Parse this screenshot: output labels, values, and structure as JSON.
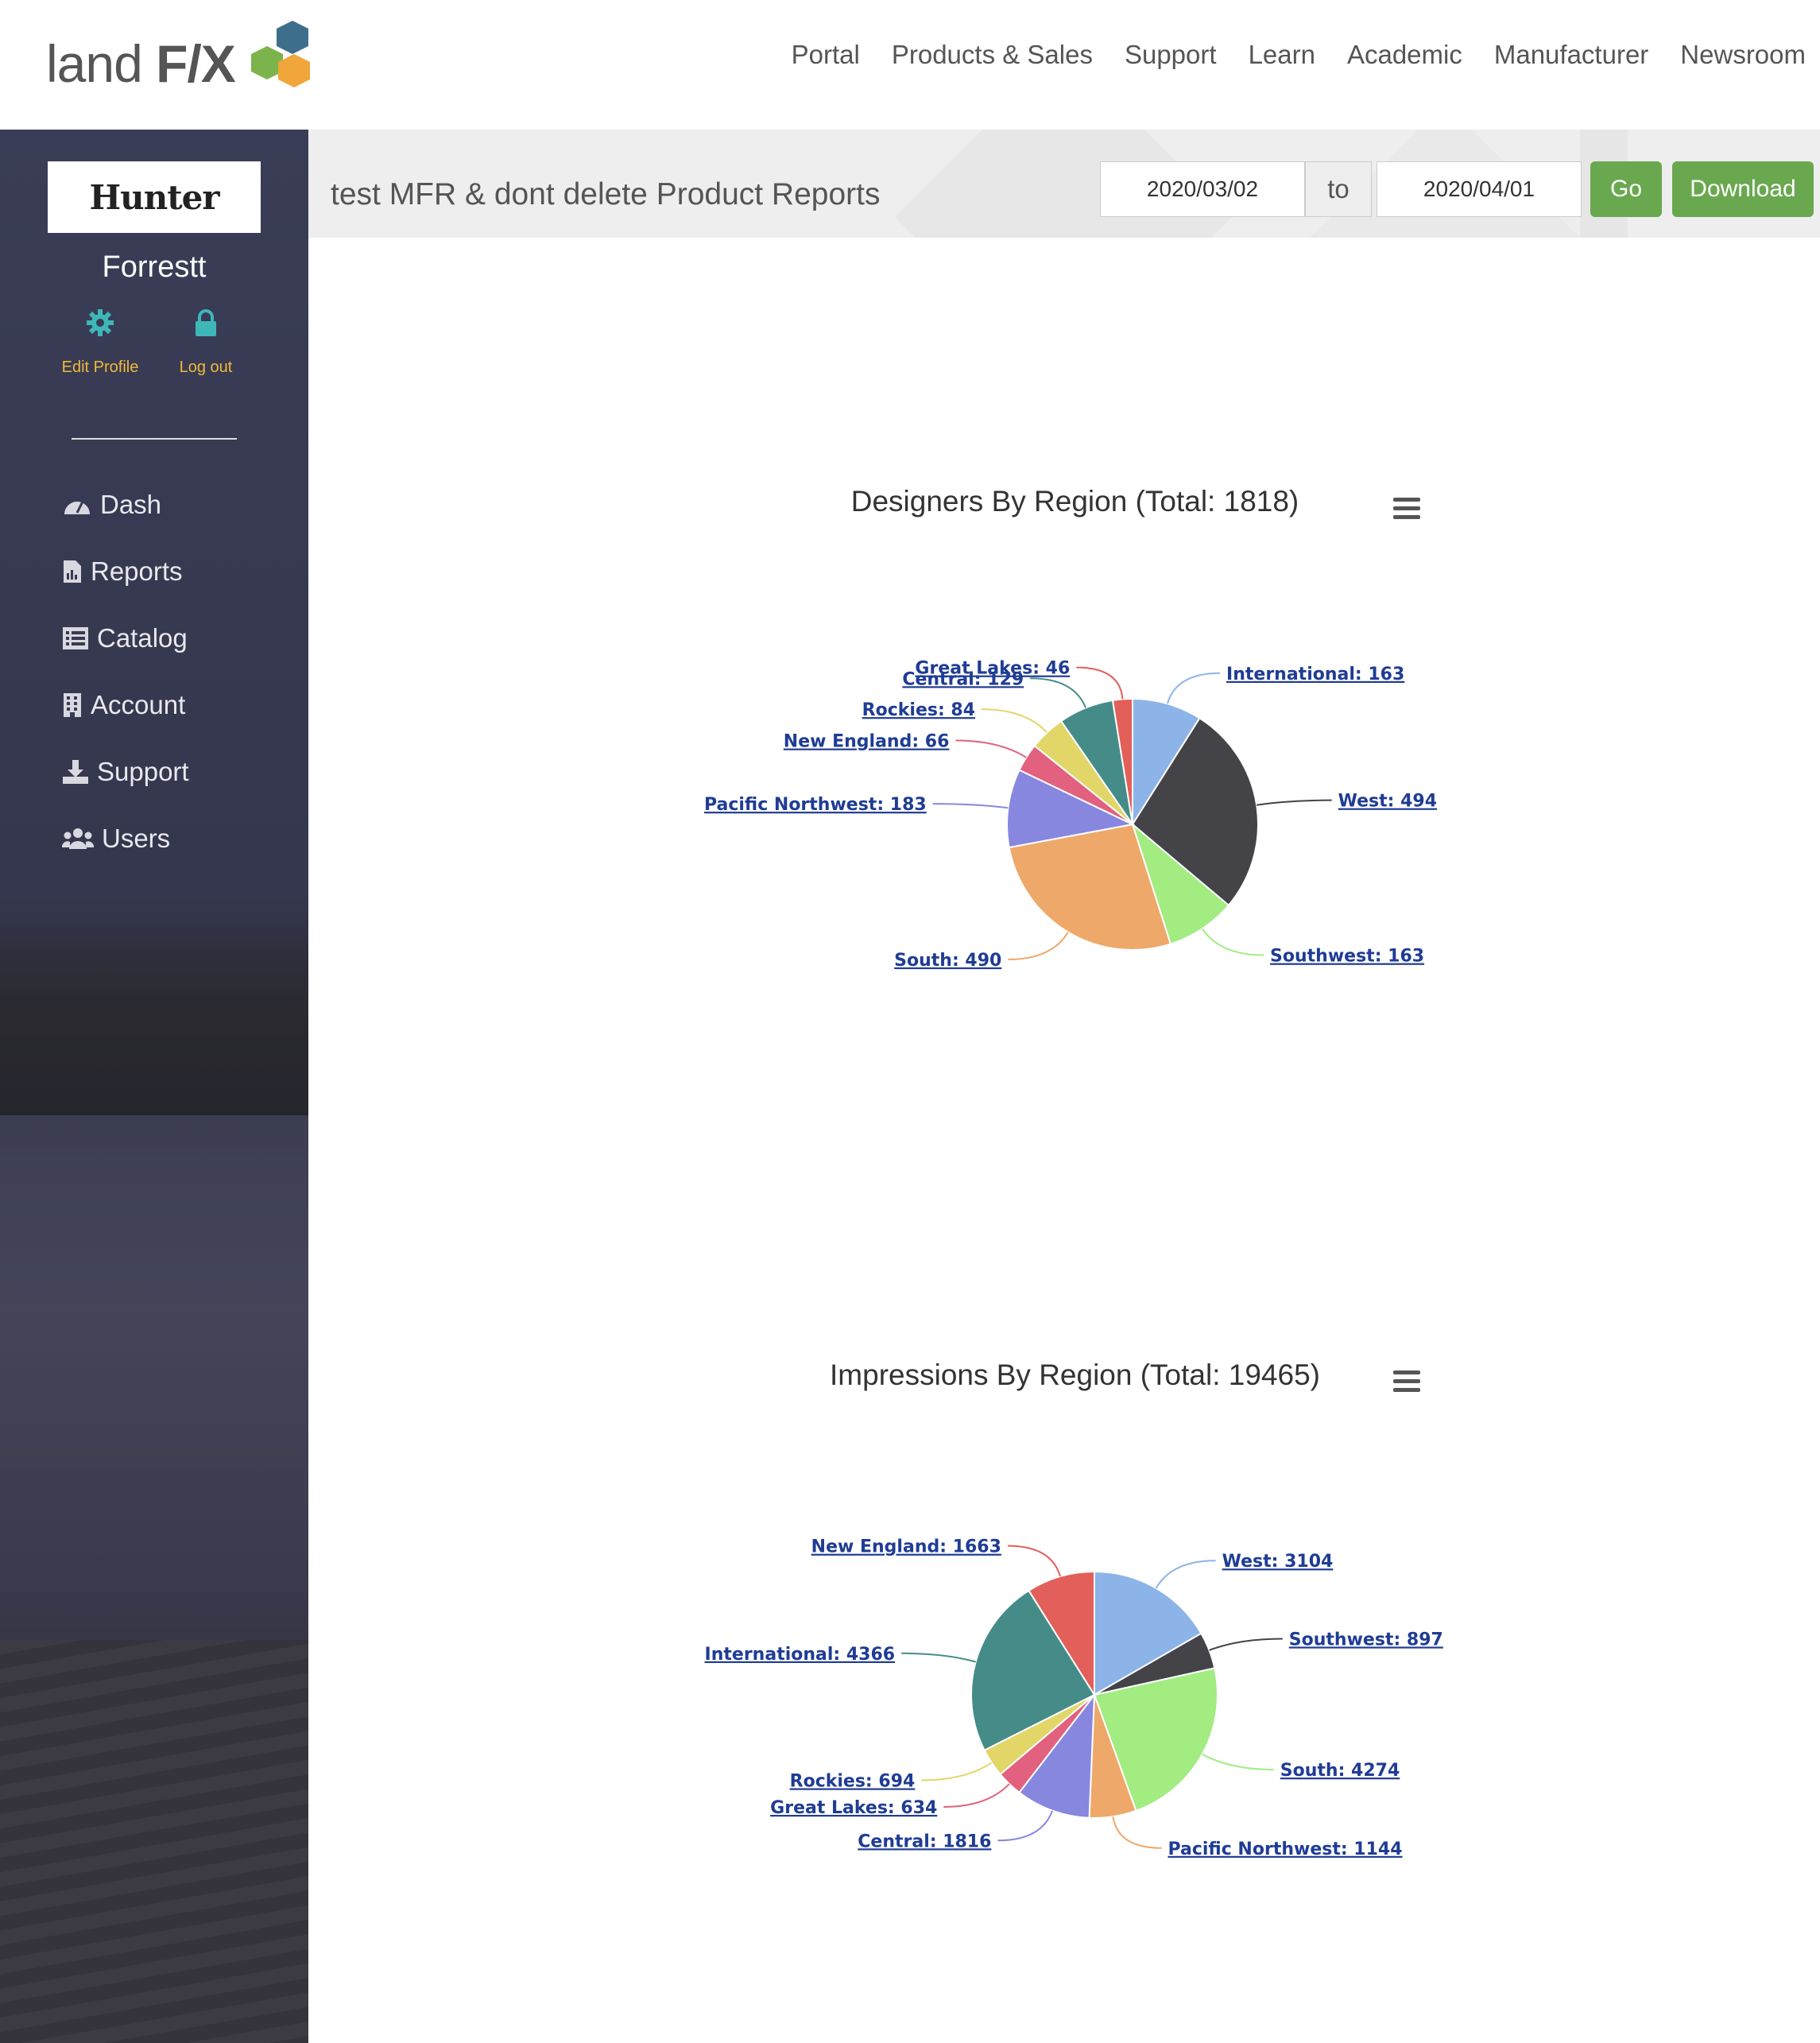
{
  "header": {
    "logo_text_light": "land",
    "logo_text_bold": "F/X",
    "nav": [
      "Portal",
      "Products & Sales",
      "Support",
      "Learn",
      "Academic",
      "Manufacturer",
      "Newsroom"
    ]
  },
  "sidebar": {
    "brand": "Hunter",
    "username": "Forrestt",
    "edit_profile": "Edit Profile",
    "logout": "Log out",
    "items": [
      {
        "label": "Dash",
        "icon": "dashboard-icon"
      },
      {
        "label": "Reports",
        "icon": "report-icon"
      },
      {
        "label": "Catalog",
        "icon": "catalog-icon"
      },
      {
        "label": "Account",
        "icon": "building-icon"
      },
      {
        "label": "Support",
        "icon": "download-icon"
      },
      {
        "label": "Users",
        "icon": "users-icon"
      }
    ]
  },
  "page": {
    "title": "test MFR & dont delete Product Reports",
    "date_from": "2020/03/02",
    "to_label": "to",
    "date_to": "2020/04/01",
    "go_label": "Go",
    "download_label": "Download"
  },
  "colors": {
    "accent_green": "#6aa84f",
    "profile_link": "#f0b93a",
    "label_link": "#1f3c95"
  },
  "chart_data": [
    {
      "type": "pie",
      "title": "Designers By Region (Total: 1818)",
      "series": [
        {
          "values": [
            {
              "name": "International",
              "value": 163,
              "label": "International: 163",
              "color": "#8db4e8"
            },
            {
              "name": "West",
              "value": 494,
              "label": "West: 494",
              "color": "#434348"
            },
            {
              "name": "Southwest",
              "value": 163,
              "label": "Southwest: 163",
              "color": "#a2ec82"
            },
            {
              "name": "South",
              "value": 490,
              "label": "South: 490",
              "color": "#eea869"
            },
            {
              "name": "Pacific Northwest",
              "value": 183,
              "label": "Pacific Northwest: 183",
              "color": "#8787e0"
            },
            {
              "name": "New England",
              "value": 66,
              "label": "New England: 66",
              "color": "#e1617e"
            },
            {
              "name": "Rockies",
              "value": 84,
              "label": "Rockies: 84",
              "color": "#e2d669"
            },
            {
              "name": "Central",
              "value": 129,
              "label": "Central: 129",
              "color": "#458c89"
            },
            {
              "name": "Great Lakes",
              "value": 46,
              "label": "Great Lakes: 46",
              "color": "#e35f5a"
            }
          ]
        }
      ]
    },
    {
      "type": "pie",
      "title": "Impressions By Region (Total: 19465)",
      "series": [
        {
          "values": [
            {
              "name": "West",
              "value": 3104,
              "label": "West: 3104",
              "color": "#8db4e8"
            },
            {
              "name": "Southwest",
              "value": 897,
              "label": "Southwest: 897",
              "color": "#434348"
            },
            {
              "name": "South",
              "value": 4274,
              "label": "South: 4274",
              "color": "#a2ec82"
            },
            {
              "name": "Pacific Northwest",
              "value": 1144,
              "label": "Pacific Northwest: 1144",
              "color": "#eea869"
            },
            {
              "name": "Central",
              "value": 1816,
              "label": "Central: 1816",
              "color": "#8787e0"
            },
            {
              "name": "Great Lakes",
              "value": 634,
              "label": "Great Lakes: 634",
              "color": "#e1617e"
            },
            {
              "name": "Rockies",
              "value": 694,
              "label": "Rockies: 694",
              "color": "#e2d669"
            },
            {
              "name": "International",
              "value": 4366,
              "label": "International: 4366",
              "color": "#458c89"
            },
            {
              "name": "New England",
              "value": 1663,
              "label": "New England: 1663",
              "color": "#e35f5a"
            }
          ]
        }
      ]
    }
  ]
}
